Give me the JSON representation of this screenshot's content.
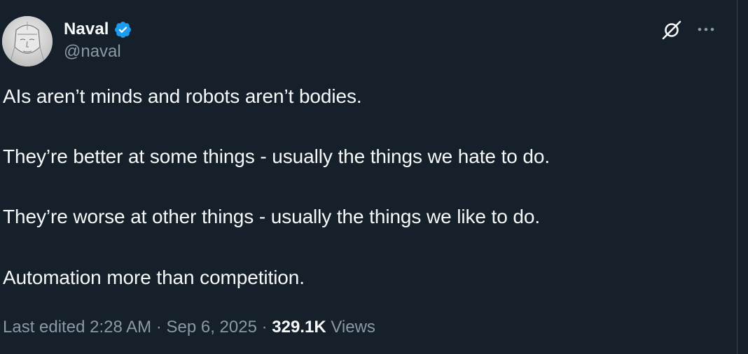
{
  "tweet": {
    "author": {
      "display_name": "Naval",
      "handle": "@naval",
      "verified": true
    },
    "lines": [
      "AIs aren’t minds and robots aren’t bodies.",
      "They’re better at some things - usually the things we hate to do.",
      "They’re worse at other things - usually the things we like to do.",
      "Automation more than competition."
    ],
    "meta": {
      "edited_label": "Last edited",
      "time": "2:28 AM",
      "separator": " · ",
      "date": "Sep 6, 2025",
      "views_count": "329.1K",
      "views_label": "Views"
    }
  },
  "icons": {
    "verified": "verified-badge-icon",
    "grok": "grok-icon",
    "more": "more-icon"
  },
  "colors": {
    "background": "#15202b",
    "text": "#f7f9f9",
    "secondary": "#8b98a5",
    "verified_blue": "#1d9bf0"
  }
}
